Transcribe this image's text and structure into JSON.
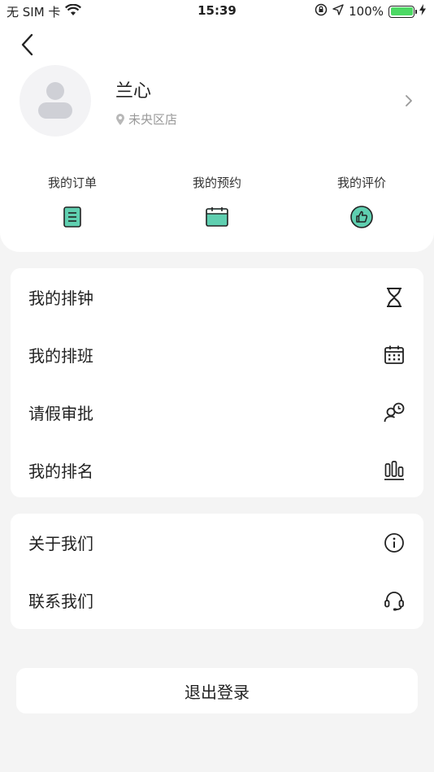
{
  "status_bar": {
    "carrier": "无 SIM 卡",
    "time": "15:39",
    "battery_percent": "100%",
    "battery_level": 1.0,
    "battery_color": "#4cd964"
  },
  "profile": {
    "name": "兰心",
    "store": "未央区店",
    "avatar_icon": "avatar-placeholder-icon"
  },
  "quick_links": [
    {
      "label": "我的订单",
      "icon": "order-list-icon"
    },
    {
      "label": "我的预约",
      "icon": "calendar-icon"
    },
    {
      "label": "我的评价",
      "icon": "thumbs-up-icon"
    }
  ],
  "menu_primary": [
    {
      "label": "我的排钟",
      "icon": "hourglass-icon"
    },
    {
      "label": "我的排班",
      "icon": "schedule-calendar-icon"
    },
    {
      "label": "请假审批",
      "icon": "person-clock-icon"
    },
    {
      "label": "我的排名",
      "icon": "bar-ranking-icon"
    }
  ],
  "menu_secondary": [
    {
      "label": "关于我们",
      "icon": "info-icon"
    },
    {
      "label": "联系我们",
      "icon": "headset-icon"
    }
  ],
  "logout_label": "退出登录",
  "colors": {
    "accent_teal": "#5fcfb0",
    "background": "#f4f4f4"
  }
}
